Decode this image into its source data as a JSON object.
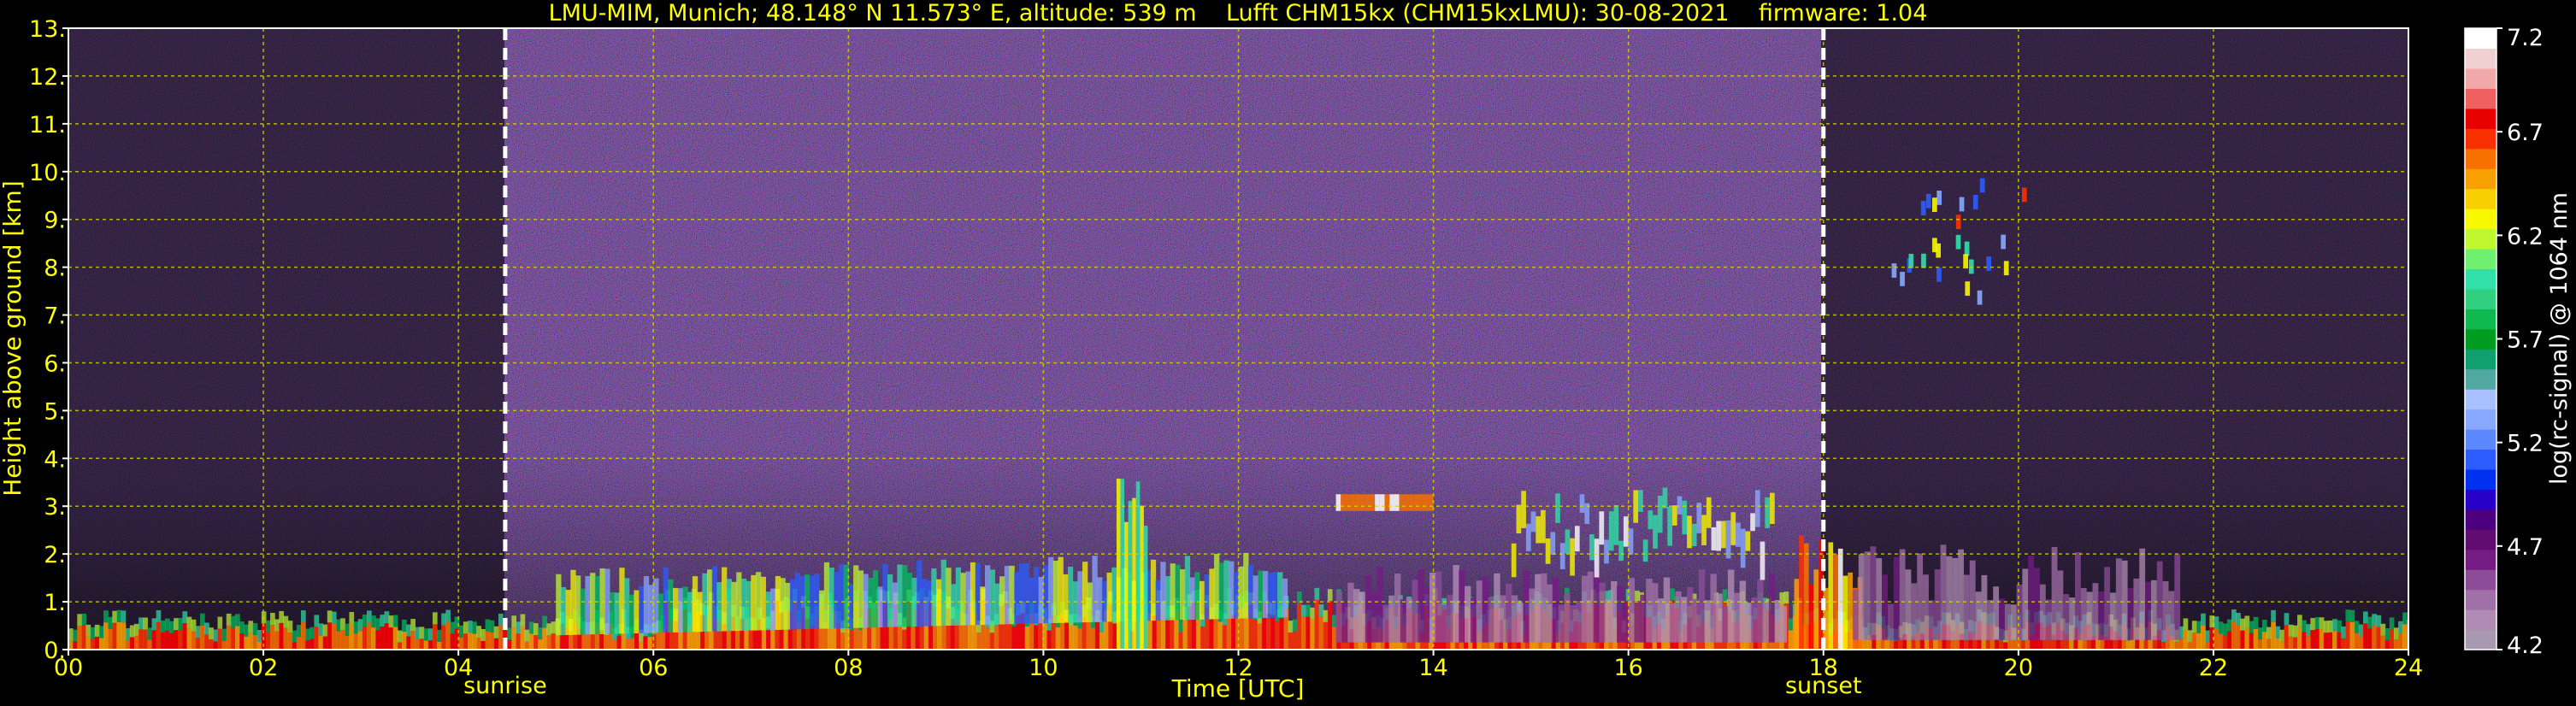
{
  "chart_data": {
    "type": "heatmap",
    "title": "LMU-MIM, Munich; 48.148° N 11.573° E, altitude: 539 m    Lufft CHM15kx (CHM15kxLMU): 30-08-2021    firmware: 1.04",
    "xlabel": "Time [UTC]",
    "ylabel": "Height above ground [km]",
    "xlim": [
      0,
      24
    ],
    "ylim": [
      0,
      13
    ],
    "x_ticks": [
      "00",
      "02",
      "04",
      "06",
      "08",
      "10",
      "12",
      "14",
      "16",
      "18",
      "20",
      "22",
      "24"
    ],
    "y_ticks": [
      "0.",
      "1.",
      "2.",
      "3.",
      "4.",
      "5.",
      "6.",
      "7.",
      "8.",
      "9.",
      "10.",
      "11.",
      "12.",
      "13."
    ],
    "grid": true,
    "markers": [
      {
        "label": "sunrise",
        "x": 4.48
      },
      {
        "label": "sunset",
        "x": 18.0
      }
    ],
    "colorbar": {
      "label": "log(rc-signal) @ 1064 nm",
      "range": [
        4.2,
        7.2
      ],
      "ticks": [
        "4.2",
        "4.7",
        "5.2",
        "5.7",
        "6.2",
        "6.7",
        "7.2"
      ],
      "colors": [
        "#a898b0",
        "#b08cb4",
        "#a070a8",
        "#8c4c98",
        "#741c84",
        "#600c70",
        "#4c0080",
        "#2800c8",
        "#0030f0",
        "#2c5cff",
        "#5c88ff",
        "#88a8ff",
        "#a8c0ff",
        "#50a8a0",
        "#10a070",
        "#009c20",
        "#10b850",
        "#30d080",
        "#30e0a8",
        "#70f070",
        "#c0f830",
        "#f8f800",
        "#f8d000",
        "#f8a000",
        "#f87000",
        "#f83000",
        "#e80000",
        "#f06060",
        "#f0a8a8",
        "#f0d0d0",
        "#ffffff"
      ]
    },
    "features": [
      {
        "kind": "boundary-layer",
        "t_start": 0,
        "t_end": 24,
        "height_km": "0.0-1.0"
      },
      {
        "kind": "aerosol-layer",
        "t_start": 5.0,
        "t_end": 12.5,
        "height_km": "0.3-1.9"
      },
      {
        "kind": "convective-plume",
        "t_start": 10.7,
        "t_end": 11.1,
        "height_km": "0.0-3.6"
      },
      {
        "kind": "cloud-layer",
        "t_start": 13.0,
        "t_end": 14.0,
        "height_km": "2.8-3.3"
      },
      {
        "kind": "cloud-layer",
        "t_start": 14.8,
        "t_end": 17.5,
        "height_km": "1.5-3.5"
      },
      {
        "kind": "cirrus",
        "t_start": 18.7,
        "t_end": 20.1,
        "height_km": "7.1-9.7"
      },
      {
        "kind": "residual-layer",
        "t_start": 18.3,
        "t_end": 21.5,
        "height_km": "0.3-2.7"
      }
    ]
  }
}
